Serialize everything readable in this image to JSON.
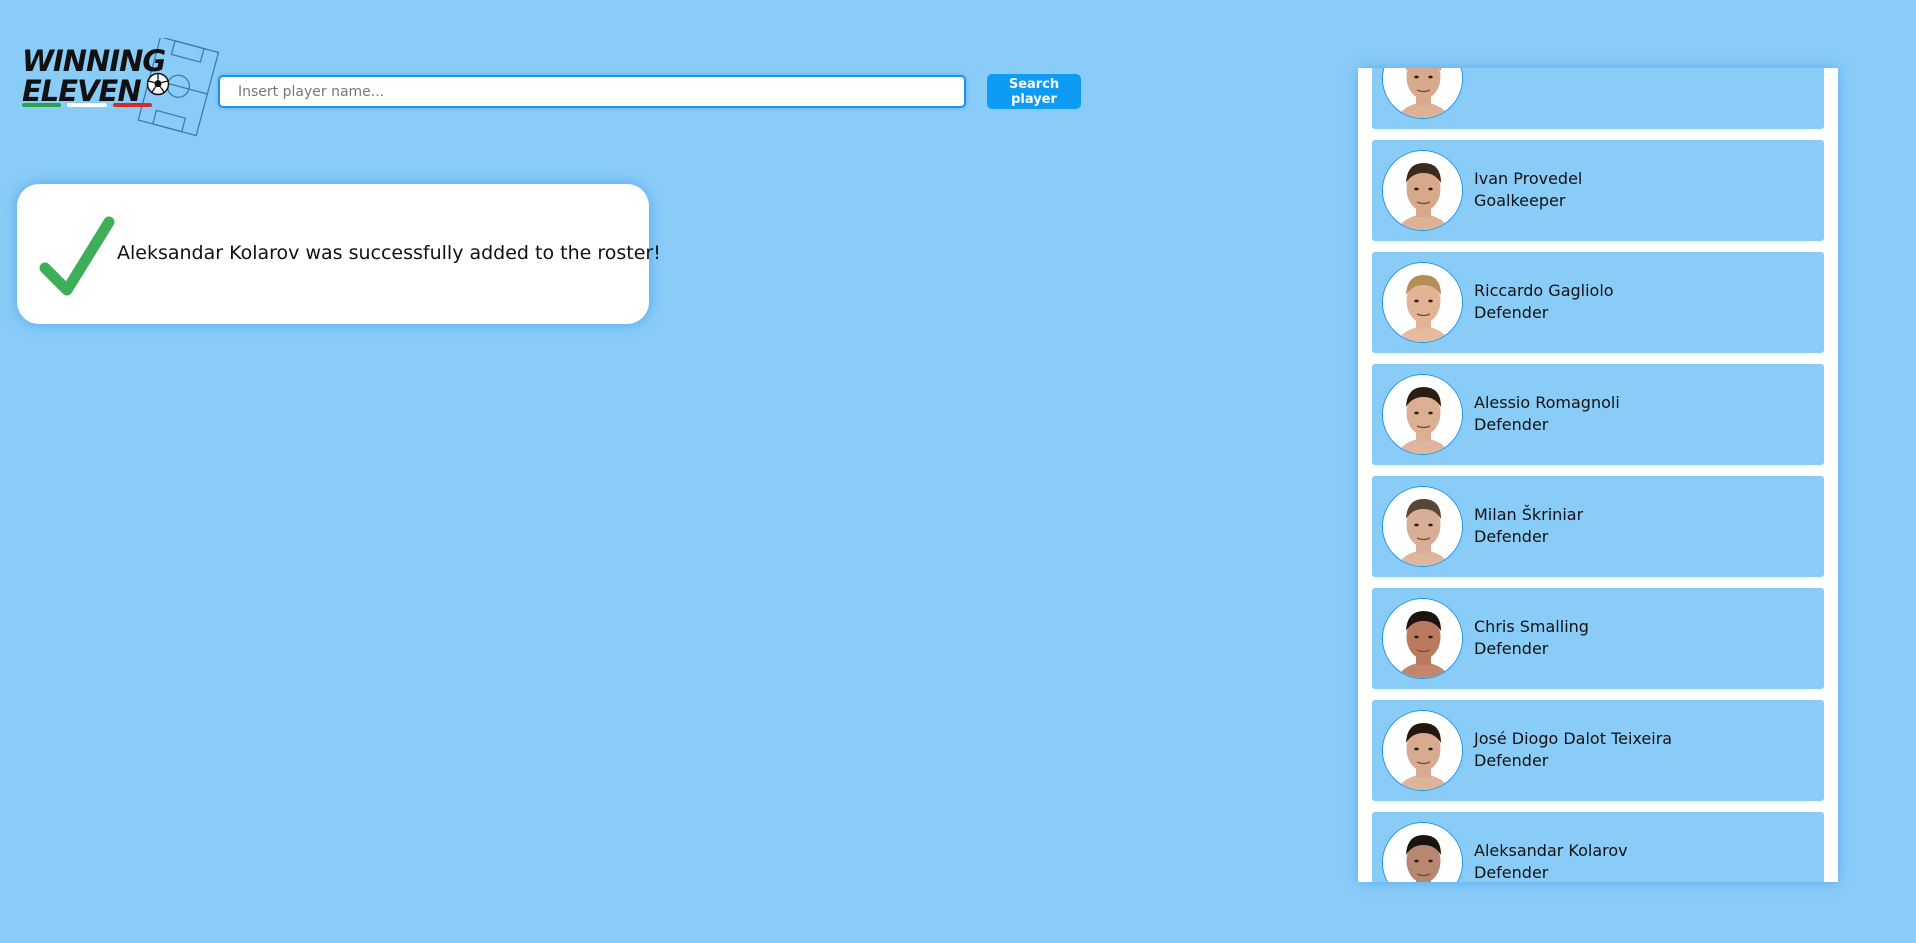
{
  "logo": {
    "line1": "WINNING",
    "line2": "ELEVEN",
    "flag_colors": [
      "#2aa14b",
      "#ffffff",
      "#d62b2b"
    ]
  },
  "search": {
    "placeholder": "Insert player name...",
    "value": "",
    "button_label": "Search player"
  },
  "toast": {
    "message": "Aleksandar Kolarov was successfully added to the roster!",
    "icon": "check-icon",
    "icon_color": "#3fae5a"
  },
  "colors": {
    "background": "#8accf8",
    "accent": "#0d9bf5"
  },
  "roster": {
    "players": [
      {
        "name": "",
        "role": "",
        "skin": "#d9a98d",
        "hair": "#b98a6a"
      },
      {
        "name": "Ivan Provedel",
        "role": "Goalkeeper",
        "skin": "#d8a88a",
        "hair": "#3a2a20"
      },
      {
        "name": "Riccardo Gagliolo",
        "role": "Defender",
        "skin": "#e2b394",
        "hair": "#b58d56"
      },
      {
        "name": "Alessio Romagnoli",
        "role": "Defender",
        "skin": "#dcae92",
        "hair": "#2a1d16"
      },
      {
        "name": "Milan Škriniar",
        "role": "Defender",
        "skin": "#d9ae96",
        "hair": "#5a4638"
      },
      {
        "name": "Chris Smalling",
        "role": "Defender",
        "skin": "#b97a5e",
        "hair": "#1c1410"
      },
      {
        "name": "José Diogo Dalot Teixeira",
        "role": "Defender",
        "skin": "#d8ab90",
        "hair": "#221810"
      },
      {
        "name": "Aleksandar Kolarov",
        "role": "Defender",
        "skin": "#b88770",
        "hair": "#1a1410"
      }
    ]
  }
}
